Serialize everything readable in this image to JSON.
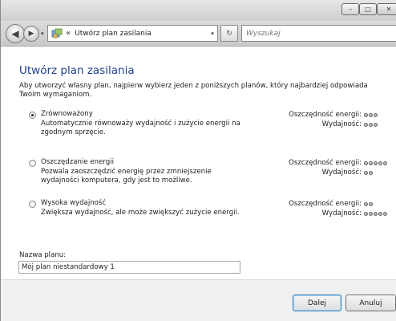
{
  "window": {
    "minimize_glyph": "–",
    "maximize_glyph": "□",
    "close_glyph": "✕"
  },
  "nav": {
    "back_glyph": "◀",
    "forward_glyph": "▶",
    "history_glyph": "▾",
    "address_separator": "«",
    "address_text": "Utwórz plan zasilania",
    "address_dropdown_glyph": "▾",
    "refresh_glyph": "↻",
    "search_placeholder": "Wyszukaj",
    "search_glyph": "⌕"
  },
  "page": {
    "title": "Utwórz plan zasilania",
    "intro": "Aby utworzyć własny plan, najpierw wybierz jeden z poniższych planów, który najbardziej odpowiada Twoim wymaganiom."
  },
  "metric_labels": {
    "saving": "Oszczędność energii:",
    "performance": "Wydajność:"
  },
  "plans": [
    {
      "name": "Zrównoważony",
      "description": "Automatycznie równoważy wydajność i zużycie energii na zgodnym sprzęcie.",
      "selected": true,
      "saving_level": 3,
      "performance_level": 3
    },
    {
      "name": "Oszczędzanie energii",
      "description": "Pozwala zaoszczędzić energię przez zmniejszenie wydajności komputera, gdy jest to możliwe.",
      "selected": false,
      "saving_level": 5,
      "performance_level": 2
    },
    {
      "name": "Wysoka wydajność",
      "description": "Zwiększa wydajność, ale może zwiększyć zużycie energii.",
      "selected": false,
      "saving_level": 2,
      "performance_level": 5
    }
  ],
  "plan_name": {
    "label": "Nazwa planu:",
    "value": "Mój plan niestandardowy 1"
  },
  "buttons": {
    "next": "Dalej",
    "cancel": "Anuluj"
  },
  "colors": {
    "title": "#1f3f8f",
    "default_button_border": "#3c7fb1"
  }
}
